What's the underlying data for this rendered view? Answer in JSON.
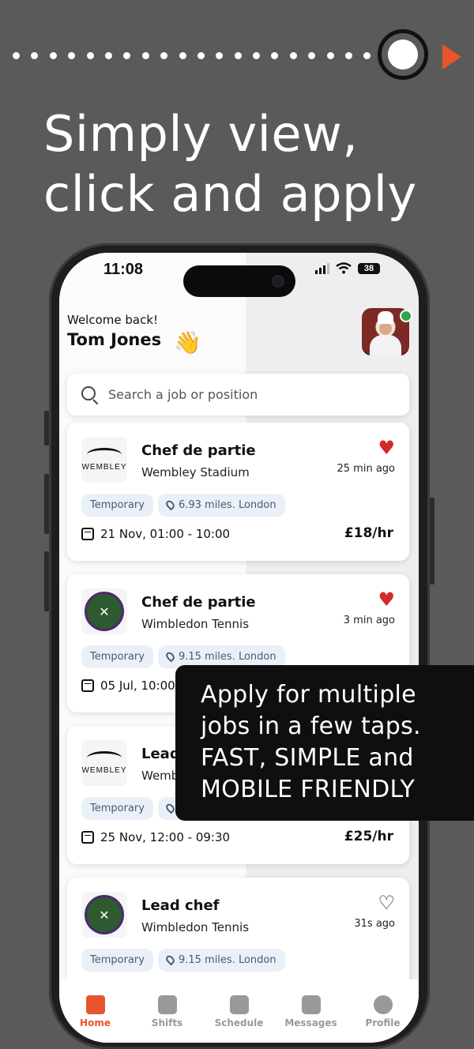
{
  "headline": {
    "line1": "Simply view,",
    "line2": "click and apply"
  },
  "status_bar": {
    "time": "11:08",
    "battery": "38"
  },
  "header": {
    "welcome": "Welcome back!",
    "user_name": "Tom Jones"
  },
  "search": {
    "placeholder": "Search a job or position"
  },
  "jobs": [
    {
      "title": "Chef de partie",
      "venue": "Wembley Stadium",
      "logo": "wembley",
      "saved": true,
      "posted": "25 min ago",
      "type": "Temporary",
      "distance": "6.93 miles. London",
      "date": "21 Nov, 01:00 - 10:00",
      "rate": "£18/hr"
    },
    {
      "title": "Chef de partie",
      "venue": "Wimbledon Tennis",
      "logo": "wimbledon",
      "saved": true,
      "posted": "3 min ago",
      "type": "Temporary",
      "distance": "9.15 miles. London",
      "date": "05 Jul, 10:00",
      "rate": ""
    },
    {
      "title": "Lead",
      "venue": "Wemb",
      "logo": "wembley",
      "saved": false,
      "posted": "",
      "type": "Temporary",
      "distance": "",
      "date": "25 Nov, 12:00 - 09:30",
      "rate": "£25/hr"
    },
    {
      "title": "Lead chef",
      "venue": "Wimbledon Tennis",
      "logo": "wimbledon",
      "saved": false,
      "posted": "31s ago",
      "type": "Temporary",
      "distance": "9.15 miles. London",
      "date": "",
      "rate": ""
    }
  ],
  "logo_text": {
    "wembley": "WEMBLEY"
  },
  "overlay": {
    "line1": "Apply for multiple",
    "line2": "jobs in a few taps.",
    "line3": "FAST, SIMPLE and",
    "line4": "MOBILE FRIENDLY"
  },
  "nav": [
    {
      "label": "Home",
      "icon": "home-icon",
      "active": true
    },
    {
      "label": "Shifts",
      "icon": "shifts-icon",
      "active": false
    },
    {
      "label": "Schedule",
      "icon": "calendar-icon",
      "active": false
    },
    {
      "label": "Messages",
      "icon": "messages-icon",
      "active": false
    },
    {
      "label": "Profile",
      "icon": "profile-icon",
      "active": false
    }
  ],
  "colors": {
    "accent": "#e8542b",
    "heart": "#d42a2a",
    "background": "#5a5a5a",
    "online": "#2aa84a"
  }
}
